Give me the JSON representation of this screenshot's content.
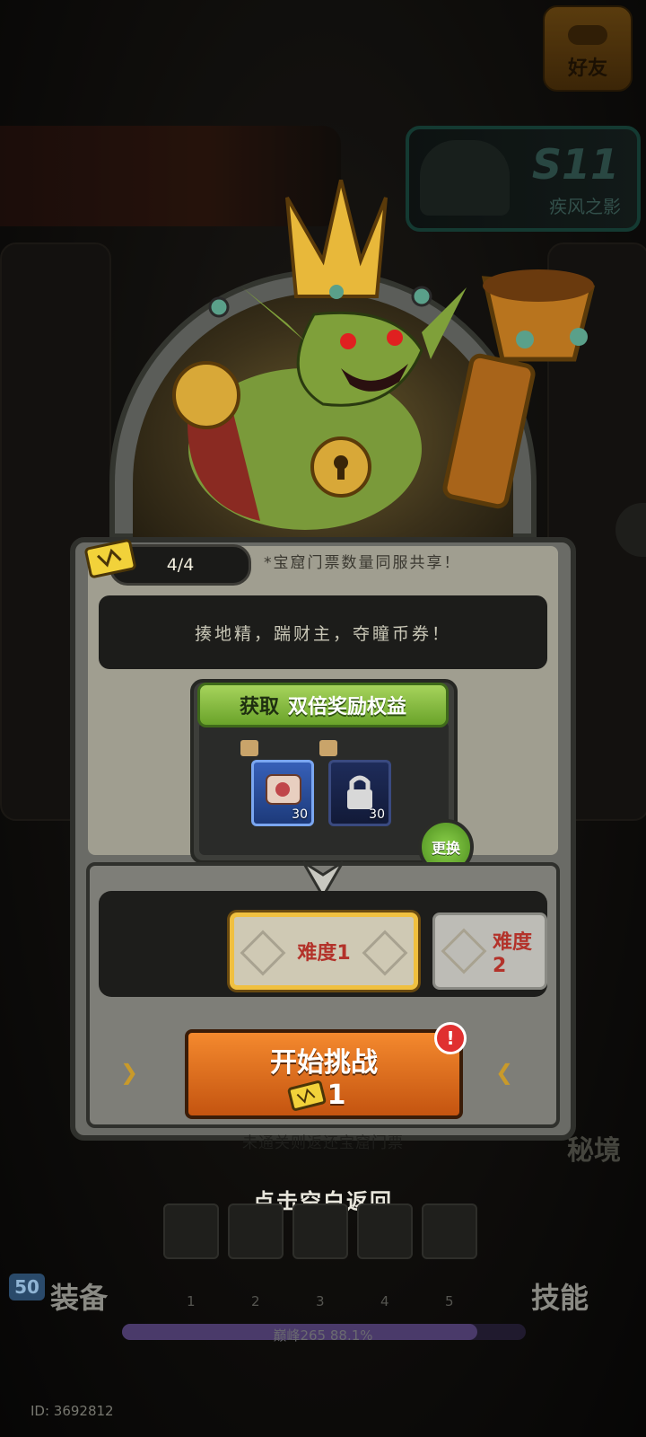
{
  "top": {
    "friend_label": "好友",
    "season_code": "S11",
    "season_name": "疾风之影"
  },
  "panel": {
    "ticket_count": "4/4",
    "shared_note": "*宝窟门票数量同服共享！",
    "description": "揍地精，踹财主，夺瞳币券！",
    "reward_header_prefix": "获取",
    "reward_header_highlight": "双倍奖励权益",
    "reward_items": [
      {
        "icon": "gift-icon",
        "name": "ticket-scroll-item",
        "qty": "30",
        "locked": false
      },
      {
        "icon": "lock-icon",
        "name": "locked-item",
        "qty": "30",
        "locked": true
      }
    ],
    "swap_label": "更换",
    "difficulties": [
      "难度1",
      "难度2"
    ],
    "start_label": "开始挑战",
    "start_cost": "1",
    "fail_note": "未通关则返还宝窟门票"
  },
  "tap_return": "点击空白返回",
  "bottom": {
    "equip_label": "装备",
    "skill_label": "技能",
    "level": "50",
    "slots": [
      "1",
      "2",
      "3",
      "4",
      "5"
    ],
    "xp_text": "巅峰265 88.1%",
    "xp_progress": 0.881,
    "side_label": "秘境",
    "uid": "ID: 3692812"
  },
  "colors": {
    "accent_green": "#7ab83a",
    "start_orange": "#e8741f",
    "difficulty_red": "#b3322a",
    "highlight_gold": "#f0c040"
  }
}
